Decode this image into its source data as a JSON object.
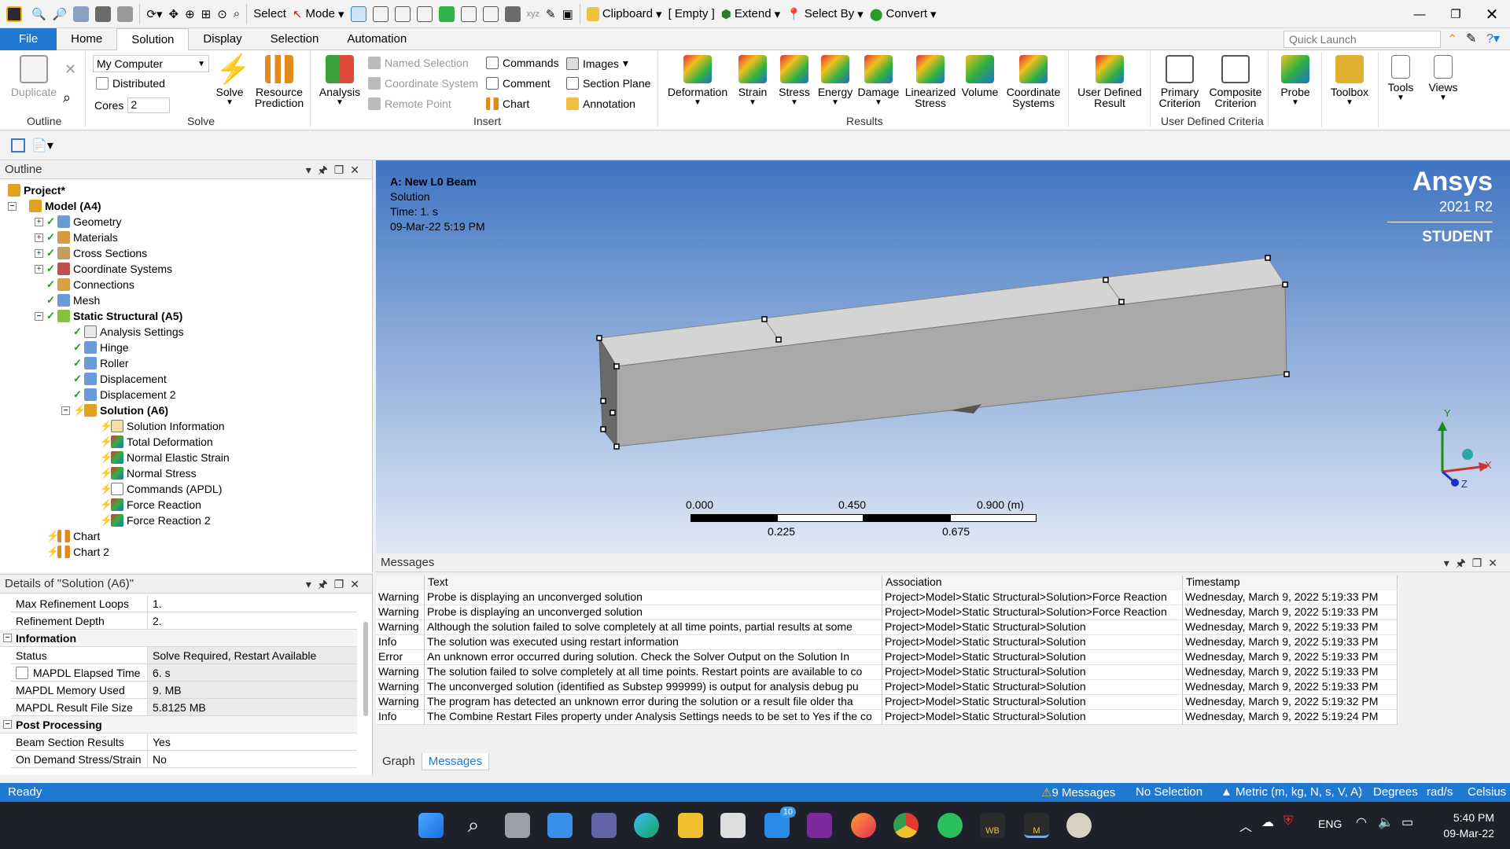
{
  "quick_toolbar": {
    "select_label": "Select",
    "mode_label": "Mode",
    "clipboard_label": "Clipboard",
    "empty_label": "[ Empty ]",
    "extend_label": "Extend",
    "select_by_label": "Select By",
    "convert_label": "Convert"
  },
  "tabs": [
    {
      "label": "File"
    },
    {
      "label": "Home"
    },
    {
      "label": "Solution"
    },
    {
      "label": "Display"
    },
    {
      "label": "Selection"
    },
    {
      "label": "Automation"
    }
  ],
  "quick_launch": {
    "placeholder": "Quick Launch"
  },
  "ribbon": {
    "outline_group": "Outline",
    "duplicate": "Duplicate",
    "solve_group": "Solve",
    "solve_target": "My Computer",
    "distributed": "Distributed",
    "cores_label": "Cores",
    "cores_value": "2",
    "solve": "Solve",
    "resource_prediction": "Resource Prediction",
    "insert_group": "Insert",
    "analysis": "Analysis",
    "named_selection": "Named Selection",
    "coordinate_system": "Coordinate System",
    "remote_point": "Remote Point",
    "commands": "Commands",
    "comment": "Comment",
    "chart": "Chart",
    "images": "Images",
    "section_plane": "Section Plane",
    "annotation": "Annotation",
    "results_group": "Results",
    "results": [
      "Deformation",
      "Strain",
      "Stress",
      "Energy",
      "Damage",
      "Linearized Stress",
      "Volume",
      "Coordinate Systems"
    ],
    "user_defined_result": "User Defined Result",
    "udc_group": "User Defined Criteria",
    "primary_criterion": "Primary Criterion",
    "composite_criterion": "Composite Criterion",
    "probe": "Probe",
    "toolbox": "Toolbox",
    "tools": "Tools",
    "views": "Views"
  },
  "outline": {
    "title": "Outline",
    "project": "Project*",
    "model": "Model (A4)",
    "geometry": "Geometry",
    "materials": "Materials",
    "cross_sections": "Cross Sections",
    "coordinate_systems": "Coordinate Systems",
    "connections": "Connections",
    "mesh": "Mesh",
    "static_structural": "Static Structural (A5)",
    "analysis_settings": "Analysis Settings",
    "hinge": "Hinge",
    "roller": "Roller",
    "displacement": "Displacement",
    "displacement2": "Displacement 2",
    "solution": "Solution (A6)",
    "solution_information": "Solution Information",
    "total_deformation": "Total Deformation",
    "normal_elastic_strain": "Normal Elastic Strain",
    "normal_stress": "Normal Stress",
    "commands_apdl": "Commands (APDL)",
    "force_reaction": "Force Reaction",
    "force_reaction2": "Force Reaction 2",
    "chart": "Chart",
    "chart2": "Chart 2"
  },
  "details": {
    "title": "Details of \"Solution (A6)\"",
    "rows1": [
      {
        "k": "Max Refinement Loops",
        "v": "1."
      },
      {
        "k": "Refinement Depth",
        "v": "2."
      }
    ],
    "sec_information": "Information",
    "rows2": [
      {
        "k": "Status",
        "v": "Solve Required, Restart Available"
      },
      {
        "k": "MAPDL Elapsed Time",
        "v": "6. s"
      },
      {
        "k": "MAPDL Memory Used",
        "v": "9. MB"
      },
      {
        "k": "MAPDL Result File Size",
        "v": "5.8125 MB"
      }
    ],
    "sec_post": "Post Processing",
    "rows3": [
      {
        "k": "Beam Section Results",
        "v": "Yes"
      },
      {
        "k": "On Demand Stress/Strain",
        "v": "No"
      }
    ]
  },
  "viewport": {
    "title": "A: New L0 Beam",
    "line2": "Solution",
    "line3": "Time: 1. s",
    "line4": "09-Mar-22 5:19 PM",
    "brand": "Ansys",
    "version": "2021 R2",
    "edition": "STUDENT",
    "scale_top": [
      "0.000",
      "0.450",
      "0.900 (m)"
    ],
    "scale_bottom": [
      "0.225",
      "0.675"
    ],
    "axis_y": "Y",
    "axis_x": "X",
    "axis_z": "Z"
  },
  "messages": {
    "title": "Messages",
    "headers": [
      "Text",
      "Association",
      "Timestamp"
    ],
    "rows": [
      {
        "type": "Warning",
        "text": "Probe is displaying an unconverged solution",
        "assoc": "Project>Model>Static Structural>Solution>Force Reaction",
        "time": "Wednesday, March 9, 2022 5:19:33 PM"
      },
      {
        "type": "Warning",
        "text": "Probe is displaying an unconverged solution",
        "assoc": "Project>Model>Static Structural>Solution>Force Reaction",
        "time": "Wednesday, March 9, 2022 5:19:33 PM"
      },
      {
        "type": "Warning",
        "text": "Although the solution failed to solve completely at all time points, partial results at some",
        "assoc": "Project>Model>Static Structural>Solution",
        "time": "Wednesday, March 9, 2022 5:19:33 PM"
      },
      {
        "type": "Info",
        "text": "The solution was executed using restart information",
        "assoc": "Project>Model>Static Structural>Solution",
        "time": "Wednesday, March 9, 2022 5:19:33 PM"
      },
      {
        "type": "Error",
        "text": "An unknown error occurred during solution.  Check the Solver Output on the Solution In",
        "assoc": "Project>Model>Static Structural>Solution",
        "time": "Wednesday, March 9, 2022 5:19:33 PM"
      },
      {
        "type": "Warning",
        "text": "The solution failed to solve completely at all time points. Restart points are available to co",
        "assoc": "Project>Model>Static Structural>Solution",
        "time": "Wednesday, March 9, 2022 5:19:33 PM"
      },
      {
        "type": "Warning",
        "text": "The unconverged solution (identified as Substep 999999) is output for analysis debug pu",
        "assoc": "Project>Model>Static Structural>Solution",
        "time": "Wednesday, March 9, 2022 5:19:33 PM"
      },
      {
        "type": "Warning",
        "text": "The program has detected an unknown error during the solution or a result file older tha",
        "assoc": "Project>Model>Static Structural>Solution",
        "time": "Wednesday, March 9, 2022 5:19:32 PM"
      },
      {
        "type": "Info",
        "text": "The Combine Restart Files property under Analysis Settings needs to be set to Yes if the co",
        "assoc": "Project>Model>Static Structural>Solution",
        "time": "Wednesday, March 9, 2022 5:19:24 PM"
      }
    ],
    "tab_graph": "Graph",
    "tab_messages": "Messages"
  },
  "status_bar": {
    "ready": "Ready",
    "messages": "9 Messages",
    "selection": "No Selection",
    "units": "Metric (m, kg, N, s, V, A)",
    "degrees": "Degrees",
    "rad": "rad/s",
    "celsius": "Celsius"
  },
  "taskbar": {
    "lang": "ENG",
    "time": "5:40 PM",
    "date": "09-Mar-22",
    "mail_badge": "10",
    "wb_label": "WB",
    "m_label": "M"
  },
  "colors": {
    "accent": "#1f79d1",
    "viewport_top": "#3f74c2",
    "viewport_bottom": "#dfe8f6"
  }
}
